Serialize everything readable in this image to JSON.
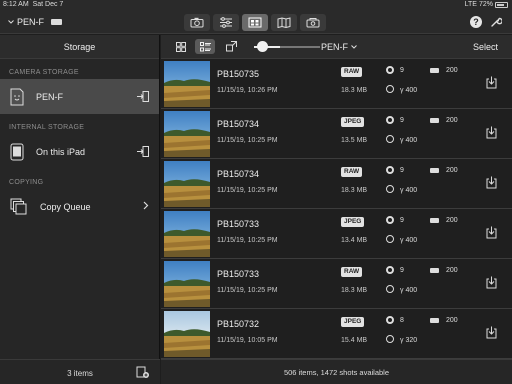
{
  "status_bar": {
    "time": "8:12 AM",
    "date": "Sat Dec 7",
    "network": "LTE",
    "battery": "72%"
  },
  "top_bar": {
    "camera_selector": "PEN-F",
    "modes": [
      {
        "name": "remote-shooting",
        "icon": "camera-icon",
        "active": false
      },
      {
        "name": "settings-adjust",
        "icon": "sliders-icon",
        "active": false
      },
      {
        "name": "import-photos",
        "icon": "gallery-icon",
        "active": true
      },
      {
        "name": "geotag",
        "icon": "map-icon",
        "active": false
      },
      {
        "name": "edit",
        "icon": "camera-bag-icon",
        "active": false
      }
    ],
    "help_label": "?"
  },
  "sidebar": {
    "title": "Storage",
    "sections": [
      {
        "label": "CAMERA STORAGE",
        "items": [
          {
            "label": "PEN-F",
            "icon": "sd-card-icon",
            "selected": true,
            "trail": "import-arrow-icon"
          }
        ]
      },
      {
        "label": "INTERNAL STORAGE",
        "items": [
          {
            "label": "On this iPad",
            "icon": "ipad-icon",
            "selected": false,
            "trail": "import-arrow-icon"
          }
        ]
      },
      {
        "label": "COPYING",
        "items": [
          {
            "label": "Copy Queue",
            "icon": "stack-icon",
            "selected": false,
            "trail": "chevron-right-icon"
          }
        ]
      }
    ],
    "footer": {
      "count": "3 items"
    }
  },
  "main": {
    "camera_filter": "PEN-F",
    "select_label": "Select",
    "zoom_level": 0.3,
    "files": [
      {
        "name": "PB150735",
        "date": "11/15/19, 10:26 PM",
        "format": "RAW",
        "size": "18.3 MB",
        "aperture": "9",
        "iso": "400",
        "iso_value": "200",
        "sky": "blue"
      },
      {
        "name": "PB150734",
        "date": "11/15/19, 10:25 PM",
        "format": "JPEG",
        "size": "13.5 MB",
        "aperture": "9",
        "iso": "400",
        "iso_value": "200",
        "sky": "blue"
      },
      {
        "name": "PB150734",
        "date": "11/15/19, 10:25 PM",
        "format": "RAW",
        "size": "18.3 MB",
        "aperture": "9",
        "iso": "400",
        "iso_value": "200",
        "sky": "blue"
      },
      {
        "name": "PB150733",
        "date": "11/15/19, 10:25 PM",
        "format": "JPEG",
        "size": "13.4 MB",
        "aperture": "9",
        "iso": "400",
        "iso_value": "200",
        "sky": "blue"
      },
      {
        "name": "PB150733",
        "date": "11/15/19, 10:25 PM",
        "format": "RAW",
        "size": "18.3 MB",
        "aperture": "9",
        "iso": "400",
        "iso_value": "200",
        "sky": "blue"
      },
      {
        "name": "PB150732",
        "date": "11/15/19, 10:05 PM",
        "format": "JPEG",
        "size": "15.4 MB",
        "aperture": "8",
        "iso": "320",
        "iso_value": "200",
        "sky": "light"
      }
    ],
    "footer": "506 items, 1472 shots available"
  },
  "colors": {
    "background": "#1e1e1e",
    "panel": "#262626",
    "selected": "#4a4a4a",
    "text": "#e6e6e6"
  }
}
